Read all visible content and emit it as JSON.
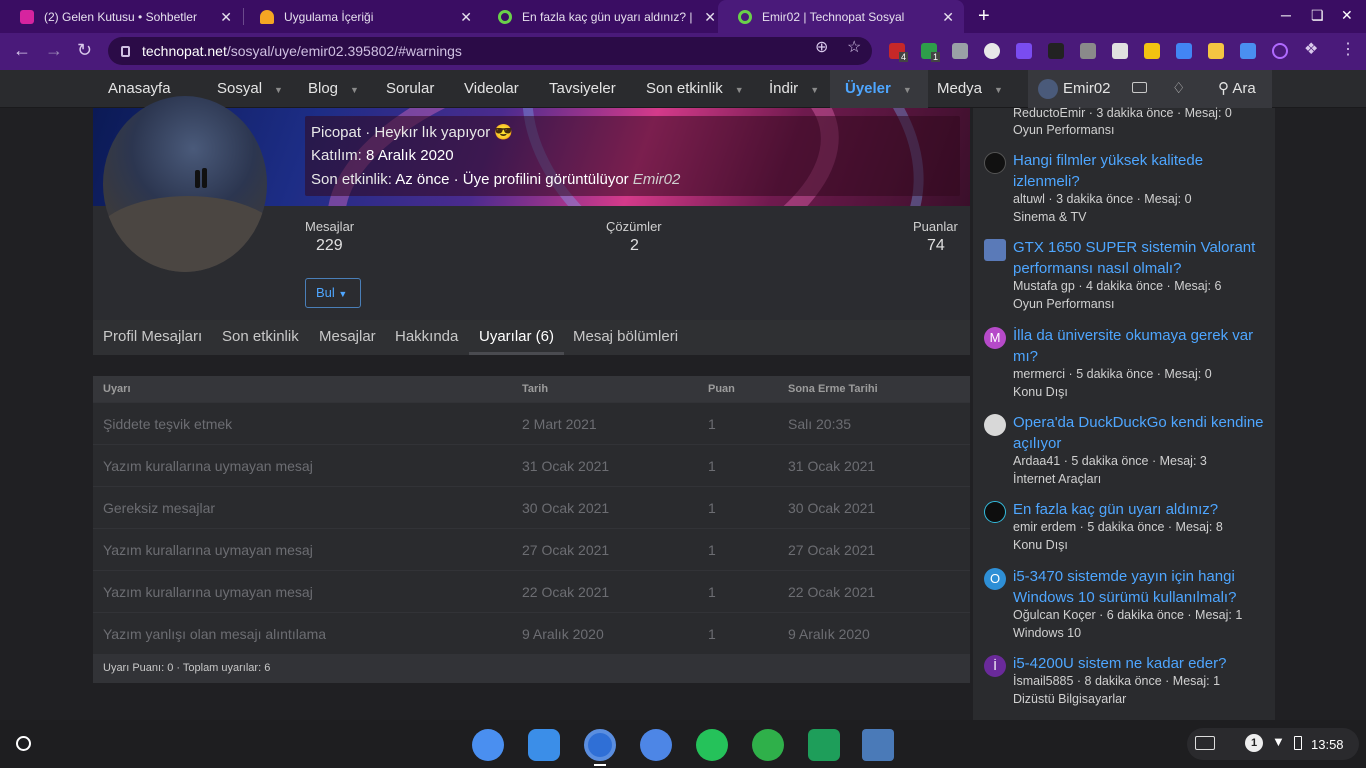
{
  "browser": {
    "tabs": [
      {
        "title": "(2) Gelen Kutusu • Sohbetler",
        "close": "✕",
        "icon": "instagram-icon",
        "color": "#d6249f"
      },
      {
        "title": "Uygulama İçeriği",
        "close": "✕",
        "icon": "app-content-icon",
        "color": "#f5a623"
      },
      {
        "title": "En fazla kaç gün uyarı aldınız? | ",
        "close": "✕",
        "icon": "technopat-icon",
        "color": "#6ad14a"
      },
      {
        "title": "Emir02 | Technopat Sosyal",
        "close": "✕",
        "icon": "technopat-icon",
        "color": "#6ad14a"
      }
    ],
    "new_tab": "+",
    "url_domain": "technopat.net",
    "url_path": "/sosyal/uye/emir02.395802/#warnings",
    "extension_badges": [
      "4",
      "1"
    ]
  },
  "site_nav": {
    "items": [
      "Anasayfa",
      "Sosyal",
      "Blog",
      "Sorular",
      "Videolar",
      "Tavsiyeler",
      "Son etkinlik",
      "İndir",
      "Üyeler",
      "Medya"
    ],
    "user": "Emir02",
    "search": "Ara"
  },
  "profile": {
    "title_label": "Picopat · Heykır lık yapıyor 😎",
    "joined_label": "Katılım:",
    "joined_value": "8 Aralık 2020",
    "last_activity_label": "Son etkinlik:",
    "last_activity_value": "Az önce · Üye profilini görüntülüyor",
    "last_activity_user": "Emir02",
    "stats": [
      {
        "label": "Mesajlar",
        "value": "229"
      },
      {
        "label": "Çözümler",
        "value": "2"
      },
      {
        "label": "Puanlar",
        "value": "74"
      }
    ],
    "find_button": "Bul",
    "tabs": [
      "Profil Mesajları",
      "Son etkinlik",
      "Mesajlar",
      "Hakkında",
      "Uyarılar (6)",
      "Mesaj bölümleri"
    ]
  },
  "warnings": {
    "headers": [
      "Uyarı",
      "Tarih",
      "Puan",
      "Sona Erme Tarihi"
    ],
    "rows": [
      [
        "Şiddete teşvik etmek",
        "2 Mart 2021",
        "1",
        "Salı 20:35"
      ],
      [
        "Yazım kurallarına uymayan mesaj",
        "31 Ocak 2021",
        "1",
        "31 Ocak 2021"
      ],
      [
        "Gereksiz mesajlar",
        "30 Ocak 2021",
        "1",
        "30 Ocak 2021"
      ],
      [
        "Yazım kurallarına uymayan mesaj",
        "27 Ocak 2021",
        "1",
        "27 Ocak 2021"
      ],
      [
        "Yazım kurallarına uymayan mesaj",
        "22 Ocak 2021",
        "1",
        "22 Ocak 2021"
      ],
      [
        "Yazım yanlışı olan mesajı alıntılama",
        "9 Aralık 2020",
        "1",
        "9 Aralık 2020"
      ]
    ],
    "footer": "Uyarı Puanı: 0 · Toplam uyarılar: 6"
  },
  "sidebar": {
    "top_meta": "ReductoEmir · 3 dakika önce · Mesaj: 0",
    "top_forum": "Oyun Performansı",
    "threads": [
      {
        "title": "Hangi filmler yüksek kalitede izlenmeli?",
        "meta": "altuwl · 3 dakika önce · Mesaj: 0",
        "forum": "Sinema & TV",
        "avatar": "",
        "color": "#111111"
      },
      {
        "title": "GTX 1650 SUPER sistemin Valorant performansı nasıl olmalı?",
        "meta": "Mustafa gp · 4 dakika önce · Mesaj: 6",
        "forum": "Oyun Performansı",
        "avatar": "",
        "color": "#5a7ab8"
      },
      {
        "title": "İlla da üniversite okumaya gerek var mı?",
        "meta": "mermerci · 5 dakika önce · Mesaj: 0",
        "forum": "Konu Dışı",
        "avatar": "M",
        "color": "#b64ac9"
      },
      {
        "title": "Opera'da DuckDuckGo kendi kendine açılıyor",
        "meta": "Ardaa41 · 5 dakika önce · Mesaj: 3",
        "forum": "İnternet Araçları",
        "avatar": "",
        "color": "#d8d8d8"
      },
      {
        "title": "En fazla kaç gün uyarı aldınız?",
        "meta": "emir erdem · 5 dakika önce · Mesaj: 8",
        "forum": "Konu Dışı",
        "avatar": "",
        "color": "#0e0e0e"
      },
      {
        "title": "i5-3470 sistemde yayın için hangi Windows 10 sürümü kullanılmalı?",
        "meta": "Oğulcan Koçer · 6 dakika önce · Mesaj: 1",
        "forum": "Windows 10",
        "avatar": "O",
        "color": "#2e8fd6"
      },
      {
        "title": "i5-4200U sistem ne kadar eder?",
        "meta": "İsmail5885 · 8 dakika önce · Mesaj: 1",
        "forum": "Dizüstü Bilgisayarlar",
        "avatar": "İ",
        "color": "#6a2a9a"
      }
    ]
  },
  "shelf": {
    "apps": [
      {
        "name": "settings-app-icon",
        "color": "#4a8ff0"
      },
      {
        "name": "files-app-icon",
        "color": "#3b8ee8"
      },
      {
        "name": "chrome-app-icon",
        "color": "#2f6fd6"
      },
      {
        "name": "camera-app-icon",
        "color": "#4d86e6"
      },
      {
        "name": "whatsapp-app-icon",
        "color": "#25c25a"
      },
      {
        "name": "android-app-icon",
        "color": "#2fb04a"
      },
      {
        "name": "calculator-app-icon",
        "color": "#1e9e5a"
      },
      {
        "name": "virtualbox-app-icon",
        "color": "#4a7ab8"
      }
    ],
    "notification_count": "1",
    "time": "13:58"
  }
}
